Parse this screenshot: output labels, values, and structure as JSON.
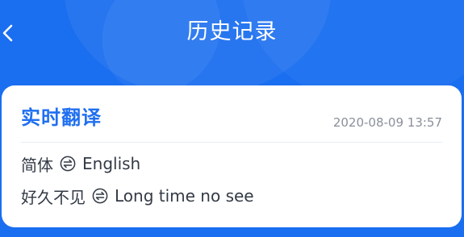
{
  "header": {
    "title": "历史记录"
  },
  "record": {
    "mode": "实时翻译",
    "timestamp": "2020-08-09 13:57",
    "language_pair": {
      "source": "简体",
      "target": "English"
    },
    "phrase": {
      "source": "好久不见",
      "target": "Long time no see"
    }
  },
  "icons": {
    "back": "chevron-left-icon",
    "swap": "swap-arrows-icon"
  },
  "colors": {
    "background": "#1a6ef0",
    "accent": "#1f6ff0",
    "card": "#ffffff"
  }
}
